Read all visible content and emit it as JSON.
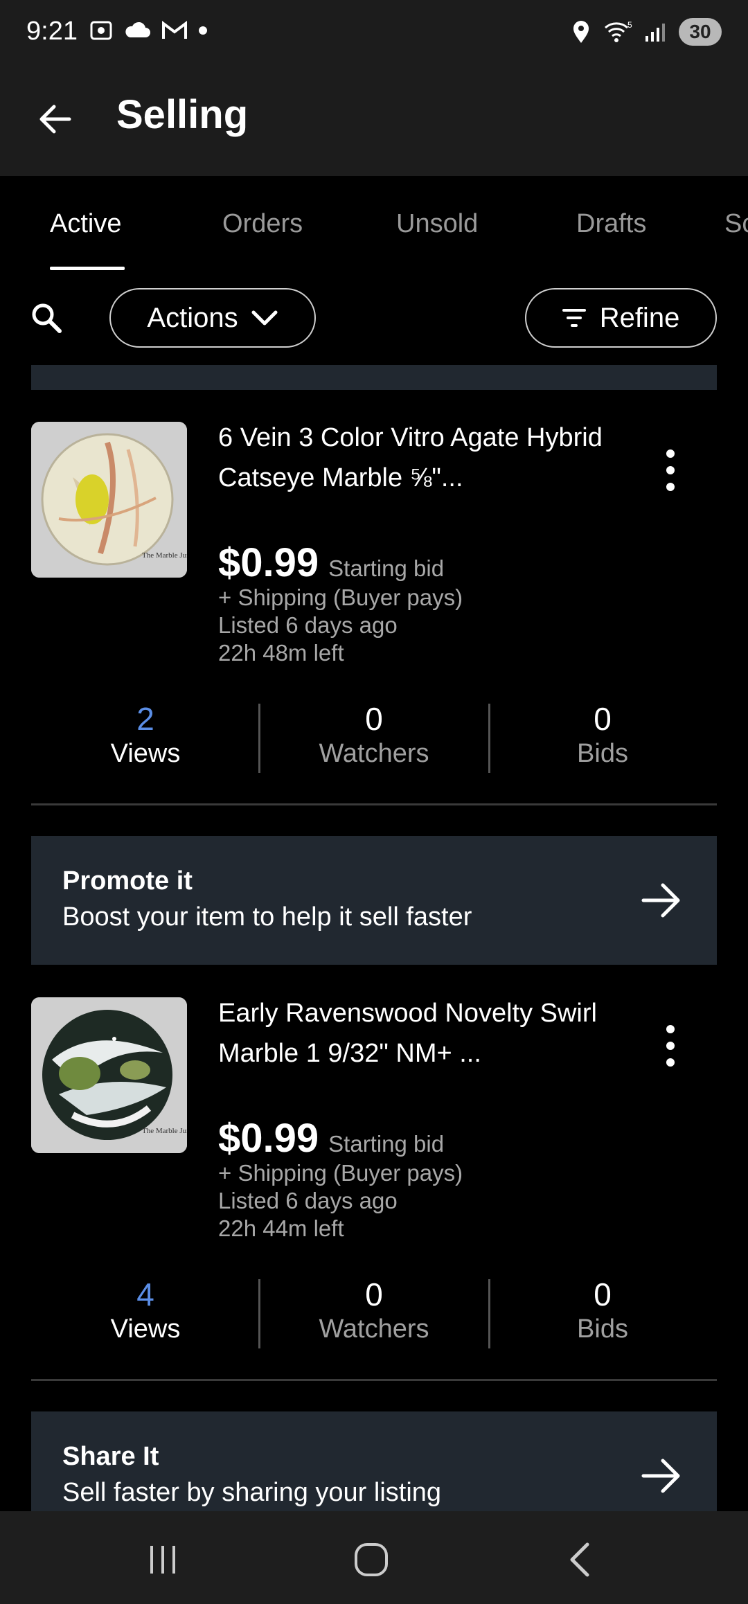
{
  "status_bar": {
    "time": "9:21",
    "battery": "30",
    "signal_label": "5"
  },
  "header": {
    "title": "Selling"
  },
  "tabs": [
    {
      "label": "Active",
      "active": true
    },
    {
      "label": "Orders"
    },
    {
      "label": "Unsold"
    },
    {
      "label": "Drafts"
    },
    {
      "label": "Sc"
    }
  ],
  "toolbar": {
    "actions_label": "Actions",
    "refine_label": "Refine"
  },
  "listings": [
    {
      "title": "6 Vein 3 Color Vitro Agate Hybrid Catseye Marble  ⅝\"...",
      "price": "$0.99",
      "price_note": "Starting bid",
      "shipping": "+ Shipping (Buyer pays)",
      "listed": "Listed 6 days ago",
      "time_left": "22h 48m left",
      "stats": {
        "views": "2",
        "views_label": "Views",
        "watchers": "0",
        "watchers_label": "Watchers",
        "bids": "0",
        "bids_label": "Bids"
      },
      "thumb_watermark": "The Marble Junkie"
    },
    {
      "title": "Early Ravenswood Novelty Swirl Marble  1 9/32\" NM+  ...",
      "price": "$0.99",
      "price_note": "Starting bid",
      "shipping": "+ Shipping (Buyer pays)",
      "listed": "Listed 6 days ago",
      "time_left": "22h 44m left",
      "stats": {
        "views": "4",
        "views_label": "Views",
        "watchers": "0",
        "watchers_label": "Watchers",
        "bids": "0",
        "bids_label": "Bids"
      },
      "thumb_watermark": "The Marble Junkie"
    }
  ],
  "promos": [
    {
      "title": "Promote it",
      "subtitle": "Boost your item to help it sell faster"
    },
    {
      "title": "Share It",
      "subtitle": "Sell faster by sharing your listing"
    }
  ],
  "colors": {
    "views_accent": "#5b8ee6",
    "card_bg": "#212830"
  }
}
